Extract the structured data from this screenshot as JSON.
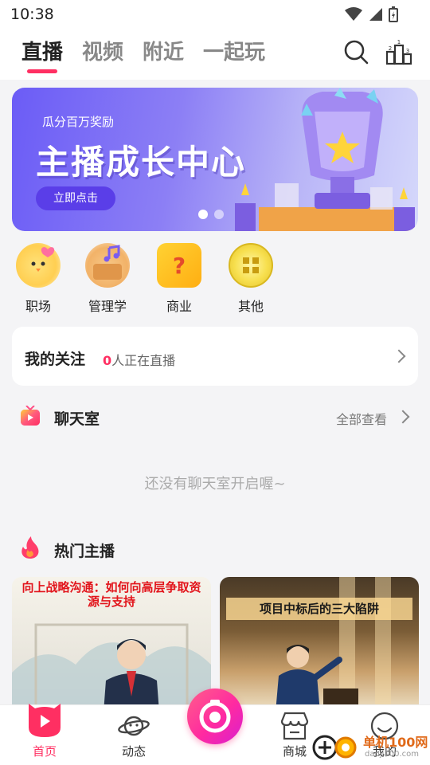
{
  "status_bar": {
    "time": "10:38"
  },
  "header": {
    "tabs": [
      {
        "label": "直播",
        "active": true
      },
      {
        "label": "视频",
        "active": false
      },
      {
        "label": "附近",
        "active": false
      },
      {
        "label": "一起玩",
        "active": false
      }
    ],
    "icons": [
      "search-icon",
      "ranking-icon"
    ],
    "accent_color": "#ff2f62"
  },
  "banner": {
    "subtitle": "瓜分百万奖励",
    "title": "主播成长中心",
    "button_label": "立即点击",
    "slides_total": 2,
    "slide_active": 1
  },
  "categories": [
    {
      "label": "职场",
      "icon": "chick-heart-icon"
    },
    {
      "label": "管理学",
      "icon": "basket-music-icon"
    },
    {
      "label": "商业",
      "icon": "question-box-icon"
    },
    {
      "label": "其他",
      "icon": "gold-circle-icon"
    }
  ],
  "follow": {
    "title": "我的关注",
    "count": "0",
    "suffix": "人正在直播"
  },
  "chat_room": {
    "title": "聊天室",
    "more_label": "全部查看",
    "empty_text": "还没有聊天室开启喔~"
  },
  "hot_streamers": {
    "title": "热门主播",
    "cards": [
      {
        "title": "向上战略沟通：如何向高层争取资源与支持"
      },
      {
        "title": "项目中标后的三大陷阱"
      }
    ]
  },
  "bottom_nav": {
    "items": [
      {
        "label": "首页",
        "active": true
      },
      {
        "label": "动态",
        "active": false
      },
      {
        "label": "商城",
        "active": false
      },
      {
        "label": "我的",
        "active": false
      }
    ]
  },
  "watermark": {
    "text": "单机100网",
    "sub": "danji100.com"
  }
}
